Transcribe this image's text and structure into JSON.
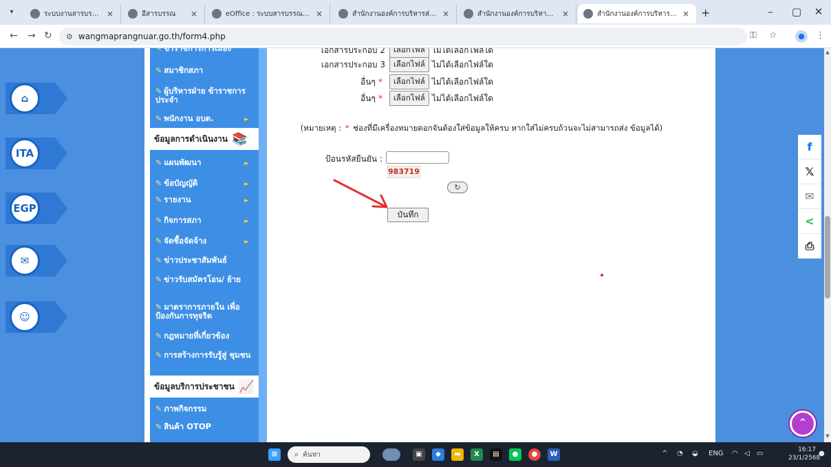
{
  "browser": {
    "tabs": [
      {
        "title": "ระบบงานสารบรรณจังหวัดจัง",
        "favicon": "globe-icon"
      },
      {
        "title": "อีสารบรรณ",
        "favicon": "page-icon"
      },
      {
        "title": "eOffice : ระบบสารบรรณอิเล็ก",
        "favicon": "page-icon"
      },
      {
        "title": "สำนักงานองค์การบริหารส่วนตำ",
        "favicon": "globe-icon"
      },
      {
        "title": "สำนักงานองค์การบริหารส่วนตำ",
        "favicon": "globe-icon"
      },
      {
        "title": "สำนักงานองค์การบริหารส่วนตำ",
        "favicon": "globe-icon",
        "active": true
      }
    ],
    "url": "wangmaprangnuar.go.th/form4.php"
  },
  "side_badges": [
    {
      "name": "home",
      "label": ""
    },
    {
      "name": "ita",
      "label": "ITA"
    },
    {
      "name": "egp",
      "label": "EGP"
    },
    {
      "name": "mail",
      "label": ""
    },
    {
      "name": "contact",
      "label": ""
    }
  ],
  "menu": {
    "items_top": [
      {
        "label": "ข้าราชการการเมือง",
        "chev": false
      },
      {
        "label": "สมาชิกสภา",
        "chev": false
      },
      {
        "label": "ผู้บริหารฝ่าย ข้าราชการประจำ",
        "chev": false
      },
      {
        "label": "พนักงาน อบต.",
        "chev": true
      }
    ],
    "section1": "ข้อมูลการดำเนินงาน",
    "items_mid": [
      {
        "label": "แผนพัฒนา",
        "chev": true
      },
      {
        "label": "ข้อบัญญัติ",
        "chev": true
      },
      {
        "label": "รายงาน",
        "chev": true
      },
      {
        "label": "กิจการสภา",
        "chev": true
      },
      {
        "label": "จัดซื้อจัดจ้าง",
        "chev": true
      },
      {
        "label": "ข่าวประชาสัมพันธ์",
        "chev": false
      },
      {
        "label": "ข่าวรับสมัครโอน/ ย้าย",
        "chev": false
      },
      {
        "label": "มาตราการภายใน เพื่อป้องกันการทุจริต",
        "chev": false
      },
      {
        "label": "กฎหมายที่เกี่ยวข้อง",
        "chev": false
      },
      {
        "label": "การสร้างการรับรู้สู่ ชุมชน",
        "chev": false
      }
    ],
    "section2": "ข้อมูลบริการประชาชน",
    "items_bottom": [
      {
        "label": "ภาพกิจกรรม",
        "chev": false
      },
      {
        "label": "สินค้า OTOP",
        "chev": false
      }
    ]
  },
  "form": {
    "partial_label": "เอกสารประกอบ 2",
    "rows": [
      {
        "label": "เอกสารประกอบ 3",
        "required": false
      },
      {
        "label": "อื่นๆ",
        "required": true
      },
      {
        "label": "อื่นๆ",
        "required": true
      }
    ],
    "file_button": "เลือกไฟล์",
    "no_file": "ไม่ได้เลือกไฟล์ใด",
    "note_prefix": "(หมายเหตุ :",
    "note_star": "*",
    "note_text": "ช่องที่มีเครื่องหมายดอกจันต้องใส่ข้อมูลให้ครบ หากใส่ไม่ครบถ้วนจะไม่สามารถส่ง ข้อมูลได้)",
    "captcha_label": "ป้อนรหัสยืนยัน :",
    "captcha_code": "983719",
    "submit": "บันทึก"
  },
  "share": [
    "facebook-icon",
    "x-icon",
    "mail-icon",
    "share-icon",
    "print-icon"
  ],
  "taskbar": {
    "search_placeholder": "ค้นหา",
    "lang": "ENG",
    "time": "16:17",
    "date": "23/1/2568"
  }
}
